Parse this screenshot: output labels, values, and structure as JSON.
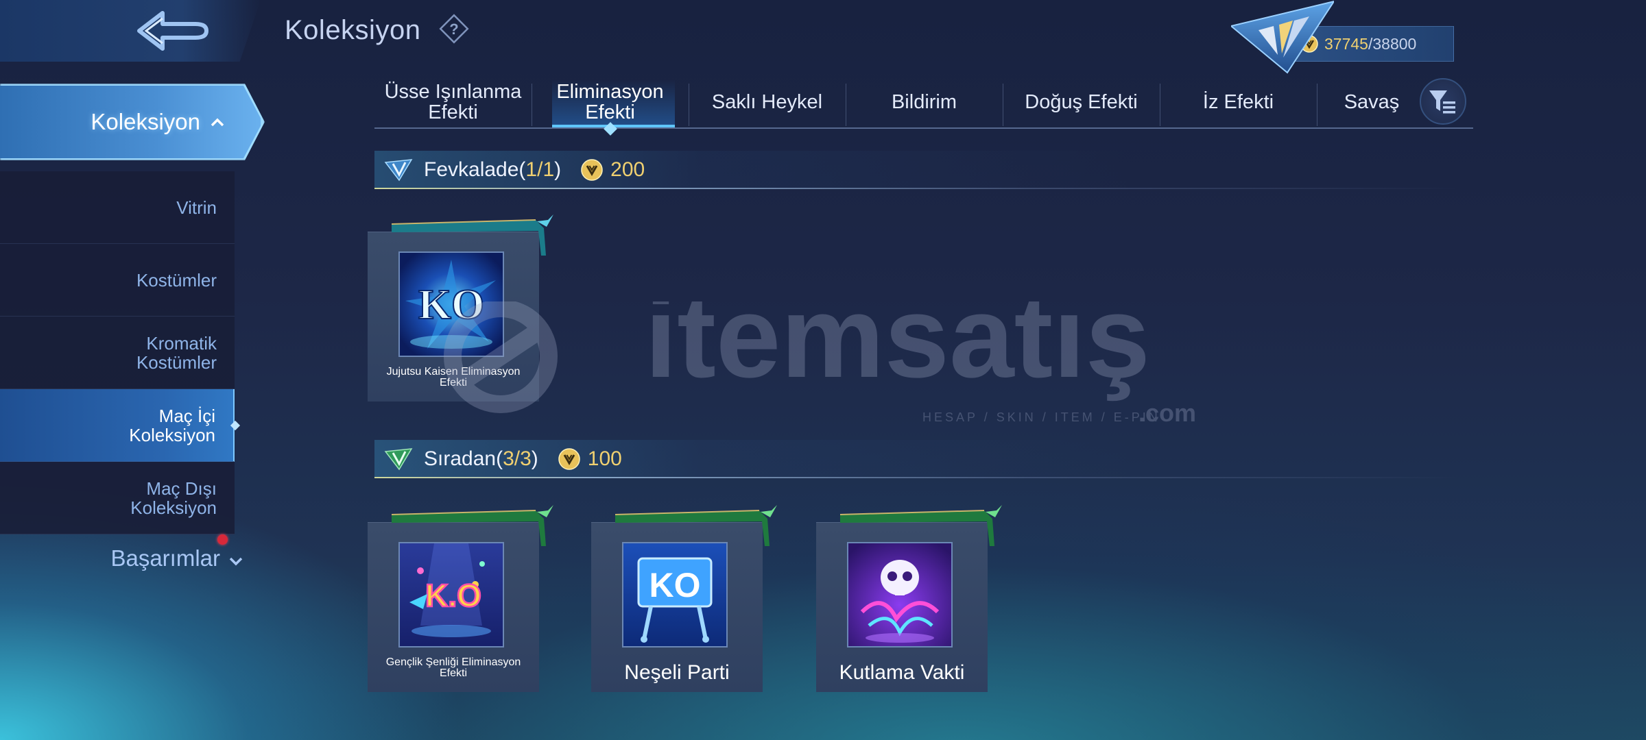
{
  "header": {
    "title": "Koleksiyon",
    "points_current": "37745",
    "points_separator": "/",
    "points_max": "38800"
  },
  "sidebar": {
    "header_label": "Koleksiyon",
    "items": [
      {
        "label": "Vitrin"
      },
      {
        "label": "Kostümler"
      },
      {
        "label": "Kromatik Kostümler"
      },
      {
        "label": "Maç İçi Koleksiyon"
      },
      {
        "label": "Maç Dışı Koleksiyon"
      }
    ],
    "achievements_label": "Başarımlar"
  },
  "tabs": [
    {
      "label": "Üsse Işınlanma Efekti"
    },
    {
      "label": "Eliminasyon Efekti"
    },
    {
      "label": "Saklı Heykel"
    },
    {
      "label": "Bildirim"
    },
    {
      "label": "Doğuş Efekti"
    },
    {
      "label": "İz Efekti"
    },
    {
      "label": "Savaş"
    }
  ],
  "active_tab": 1,
  "sections": [
    {
      "title": "Fevkalade",
      "count_open": "(",
      "count": "1/1",
      "count_close": ")",
      "cost": "200",
      "items": [
        {
          "name": "Jujutsu Kaisen Eliminasyon Efekti"
        }
      ]
    },
    {
      "title": "Sıradan",
      "count_open": "(",
      "count": "3/3",
      "count_close": ")",
      "cost": "100",
      "items": [
        {
          "name": "Gençlik Şenliği Eliminasyon Efekti"
        },
        {
          "name": "Neşeli Parti"
        },
        {
          "name": "Kutlama Vakti"
        }
      ]
    }
  ],
  "watermark": {
    "brand": "itemsatış",
    "tagline": "HESAP / SKIN / ITEM / E-PIN",
    "suffix": ".com"
  },
  "colors": {
    "accent_gold": "#f0d070",
    "accent_blue": "#5fc6ff",
    "notification_red": "#d8283a"
  },
  "icons": [
    "back-arrow-icon",
    "help-icon",
    "rank-emblem-icon",
    "coin-icon",
    "chevron-up-icon",
    "chevron-down-icon",
    "filter-icon",
    "rarity-icon"
  ]
}
